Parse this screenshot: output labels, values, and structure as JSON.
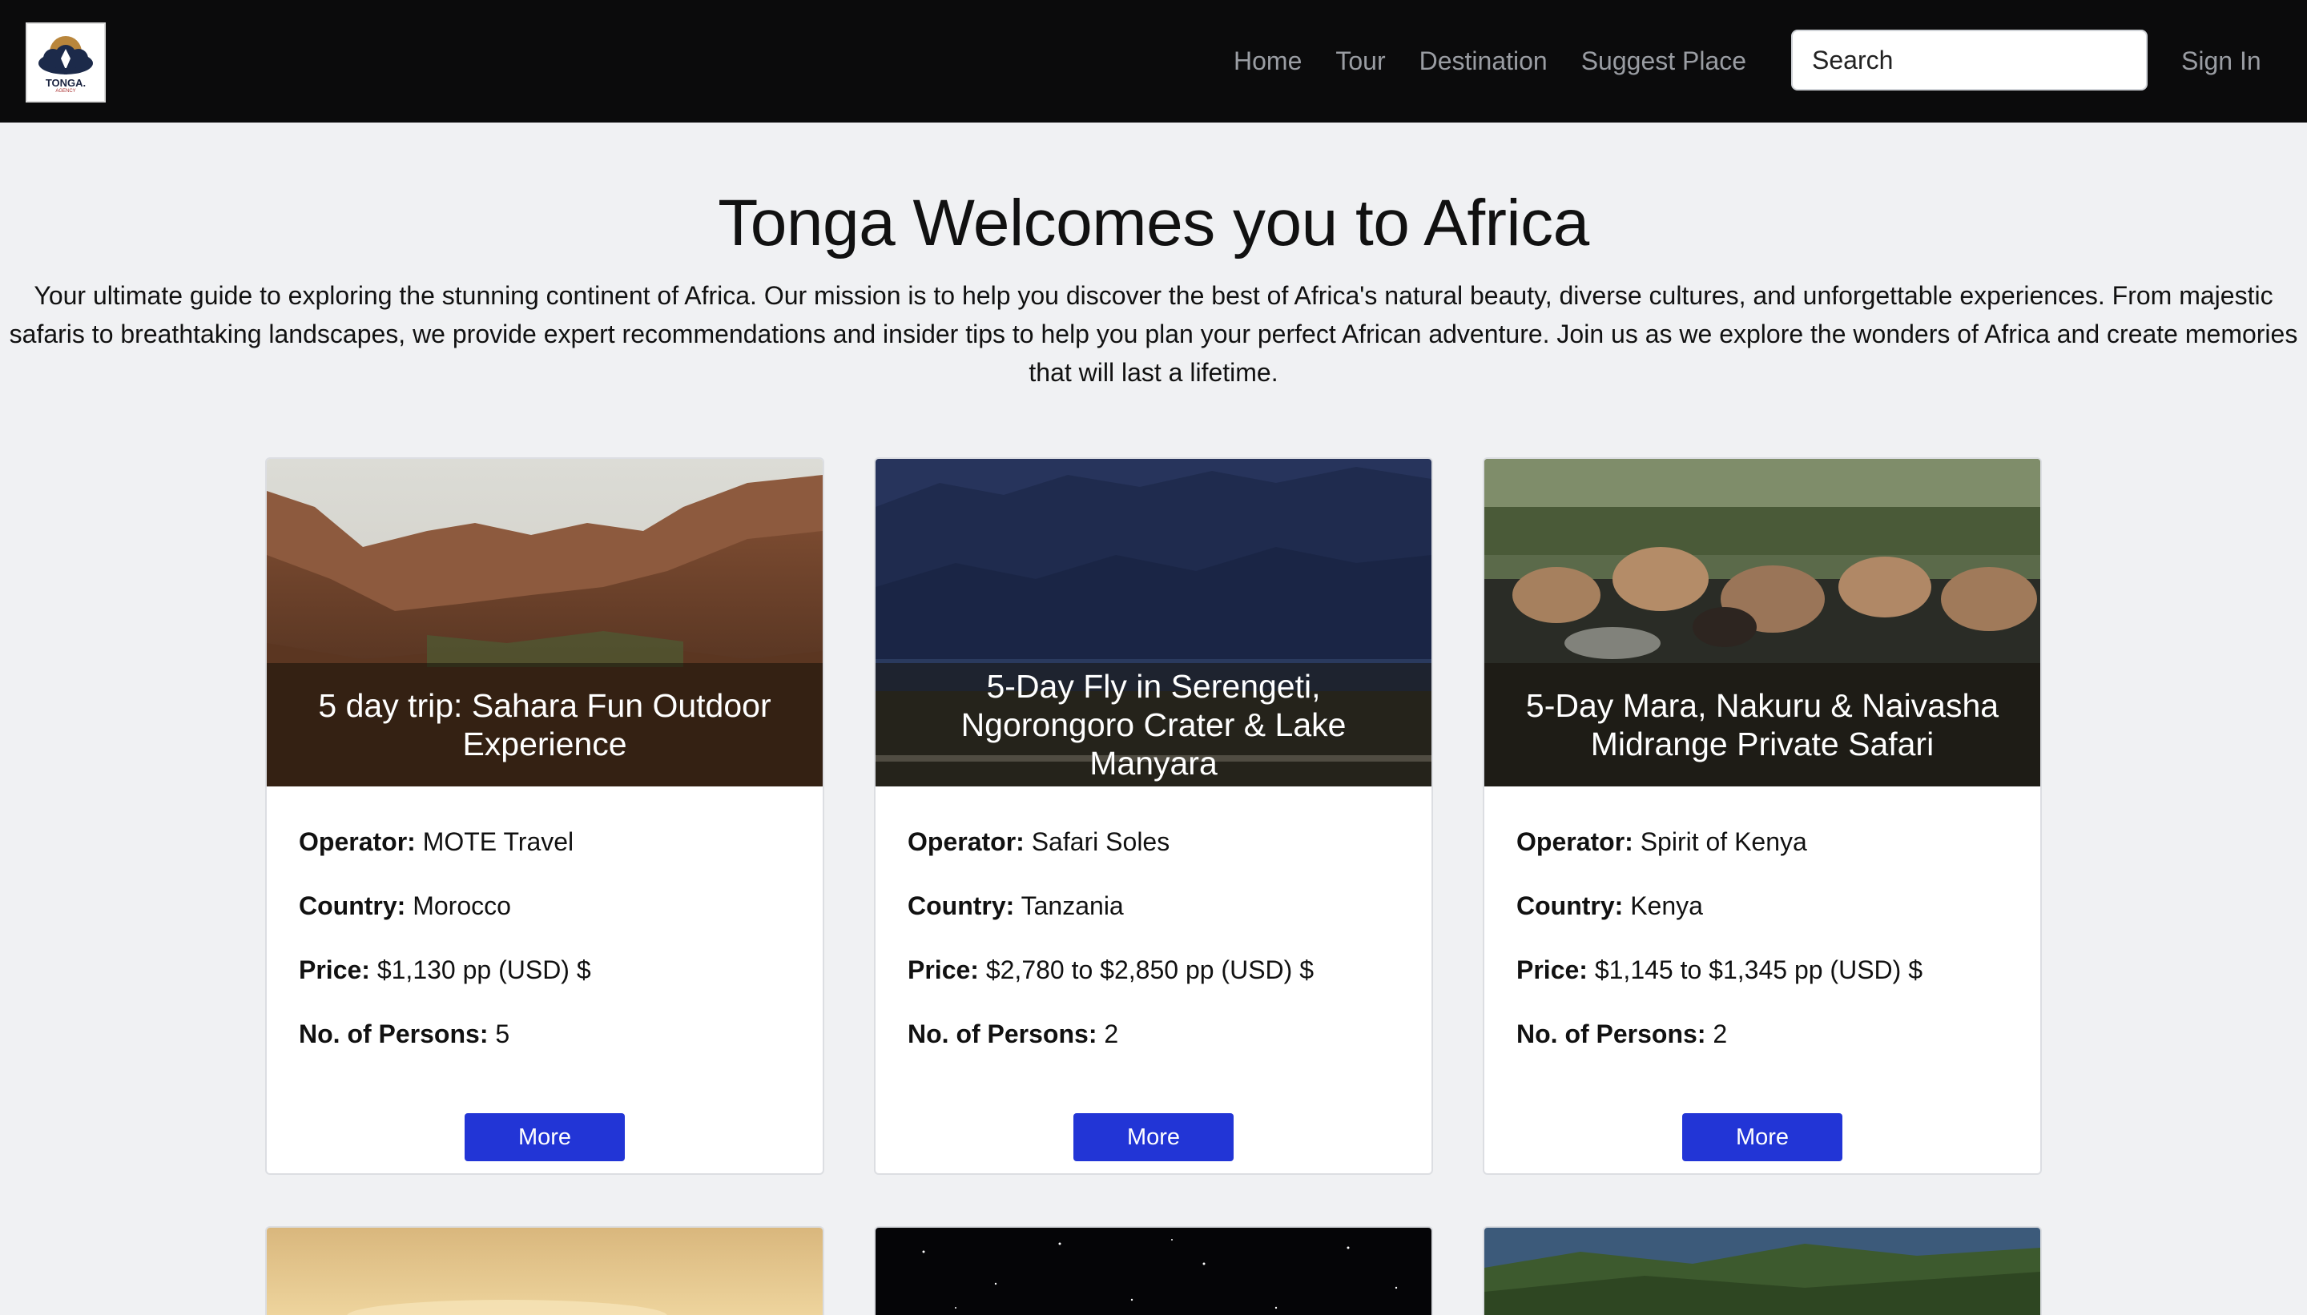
{
  "brand": {
    "logo_text": "TONGA.",
    "logo_sub": "AGENCY"
  },
  "nav": {
    "links": [
      "Home",
      "Tour",
      "Destination",
      "Suggest Place"
    ],
    "search_placeholder": "Search",
    "signin": "Sign In"
  },
  "hero": {
    "title": "Tonga Welcomes you to Africa",
    "description": "Your ultimate guide to exploring the stunning continent of Africa. Our mission is to help you discover the best of Africa's natural beauty, diverse cultures, and unforgettable experiences. From majestic safaris to breathtaking landscapes, we provide expert recommendations and insider tips to help you plan your perfect African adventure. Join us as we explore the wonders of Africa and create memories that will last a lifetime."
  },
  "labels": {
    "operator": "Operator:",
    "country": "Country:",
    "price": "Price:",
    "persons": "No. of Persons:"
  },
  "cards": [
    {
      "title": "5 day trip: Sahara Fun Outdoor Experience",
      "operator": "MOTE Travel",
      "country": "Morocco",
      "price": "$1,130 pp (USD) $",
      "persons": "5",
      "button": "More"
    },
    {
      "title": "5-Day Fly in Serengeti, Ngorongoro Crater & Lake Manyara",
      "operator": "Safari Soles",
      "country": "Tanzania",
      "price": "$2,780 to $2,850 pp (USD) $",
      "persons": "2",
      "button": "More"
    },
    {
      "title": "5-Day Mara, Nakuru & Naivasha Midrange Private Safari",
      "operator": "Spirit of Kenya",
      "country": "Kenya",
      "price": "$1,145 to $1,345 pp (USD) $",
      "persons": "2",
      "button": "More"
    }
  ]
}
